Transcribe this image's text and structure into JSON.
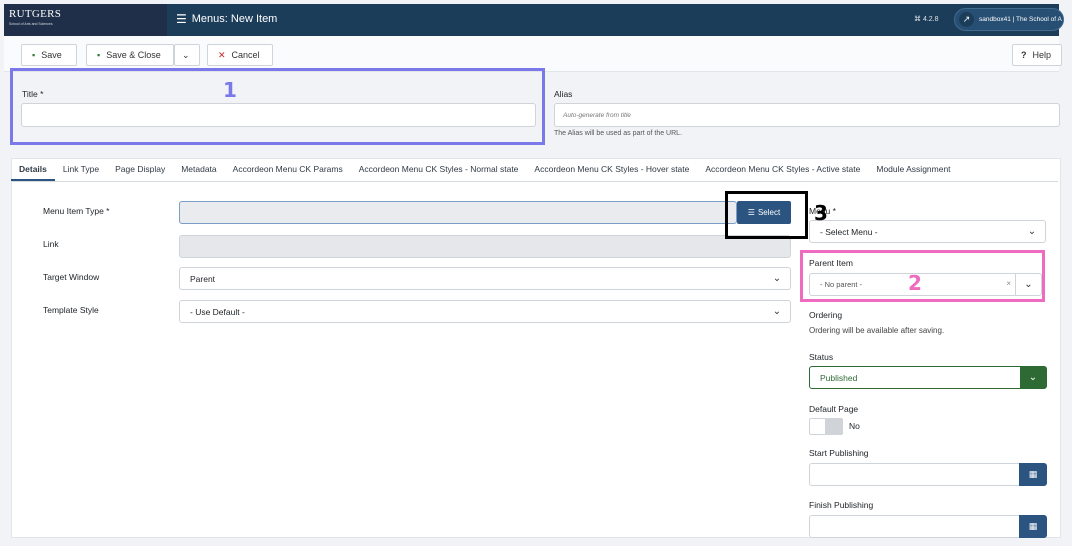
{
  "header": {
    "brand_logo": "RUTGERS",
    "brand_sub": "School of Arts and Sciences",
    "page_title": "Menus: New Item",
    "version": "⌘ 4.2.8",
    "site_name": "sandbox41 | The School of A"
  },
  "toolbar": {
    "save_label": "Save",
    "save_close_label": "Save & Close",
    "cancel_label": "Cancel",
    "help_label": "Help"
  },
  "form": {
    "title_label": "Title *",
    "title_value": "",
    "alias_label": "Alias",
    "alias_placeholder": "Auto-generate from title",
    "alias_help": "The Alias will be used as part of the URL."
  },
  "tabs": [
    {
      "label": "Details",
      "active": true
    },
    {
      "label": "Link Type"
    },
    {
      "label": "Page Display"
    },
    {
      "label": "Metadata"
    },
    {
      "label": "Accordeon Menu CK Params"
    },
    {
      "label": "Accordeon Menu CK Styles - Normal state"
    },
    {
      "label": "Accordeon Menu CK Styles - Hover state"
    },
    {
      "label": "Accordeon Menu CK Styles - Active state"
    },
    {
      "label": "Module Assignment"
    }
  ],
  "details": {
    "menu_item_type_label": "Menu Item Type *",
    "select_button_label": "Select",
    "link_label": "Link",
    "target_window_label": "Target Window",
    "target_window_value": "Parent",
    "template_style_label": "Template Style",
    "template_style_value": "- Use Default -"
  },
  "sidebar": {
    "menu_label": "Menu *",
    "menu_value": "- Select Menu -",
    "parent_item_label": "Parent Item",
    "parent_item_value": "- No parent -",
    "parent_clear": "×",
    "ordering_label": "Ordering",
    "ordering_text": "Ordering will be available after saving.",
    "status_label": "Status",
    "status_value": "Published",
    "default_page_label": "Default Page",
    "default_page_value": "No",
    "start_publishing_label": "Start Publishing",
    "finish_publishing_label": "Finish Publishing"
  },
  "annotations": {
    "one": "1",
    "two": "2",
    "three": "3"
  },
  "colors": {
    "header_bg": "#1c3d5a",
    "accent": "#2b5580",
    "annotation_blue": "#7b79ea",
    "annotation_pink": "#ee6bc0",
    "status_green": "#2e6b34"
  }
}
